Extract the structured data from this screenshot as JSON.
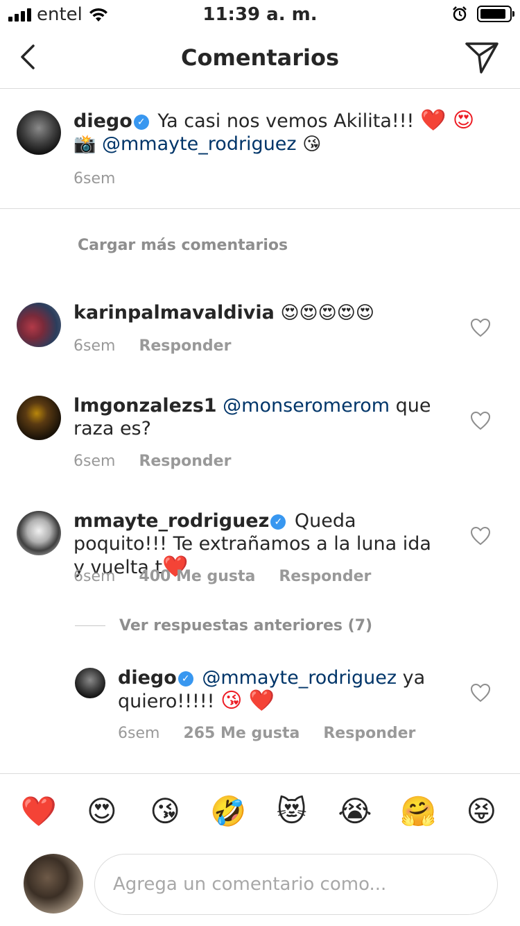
{
  "status_bar": {
    "carrier": "entel",
    "time": "11:39 a. m.",
    "battery_level": 0.9
  },
  "header": {
    "title": "Comentarios"
  },
  "caption": {
    "username": "diego",
    "verified": true,
    "text": "Ya casi nos vemos Akilita!!!",
    "emojis_1": "❤️ 😍",
    "camera_emoji": "📸",
    "mention": "@mmayte_rodriguez",
    "emojis_2": "😘",
    "time": "6sem"
  },
  "load_more_label": "Cargar más comentarios",
  "comments": [
    {
      "username": "karinpalmavaldivia",
      "text": "😍😍😍😍😍",
      "time": "6sem",
      "reply_label": "Responder"
    },
    {
      "username": "lmgonzalezs1",
      "mention": "@monseromerom",
      "text": " que raza es?",
      "time": "6sem",
      "reply_label": "Responder"
    },
    {
      "username": "mmayte_rodriguez",
      "verified": true,
      "text": "Queda poquito!!! Te extrañamos a la luna ida y vuelta t",
      "emoji": "❤️",
      "time": "6sem",
      "likes": "400 Me gusta",
      "reply_label": "Responder"
    }
  ],
  "view_replies_label": "Ver respuestas anteriores (7)",
  "reply": {
    "username": "diego",
    "verified": true,
    "mention": "@mmayte_rodriguez",
    "text": " ya quiero!!!!!",
    "emojis": "😘 ❤️",
    "time": "6sem",
    "likes": "265 Me gusta",
    "reply_label": "Responder"
  },
  "quick_emojis": [
    "❤️",
    "😍",
    "😘",
    "🤣",
    "😻",
    "😭",
    "🤗",
    "😝"
  ],
  "composer": {
    "placeholder": "Agrega un comentario como..."
  }
}
